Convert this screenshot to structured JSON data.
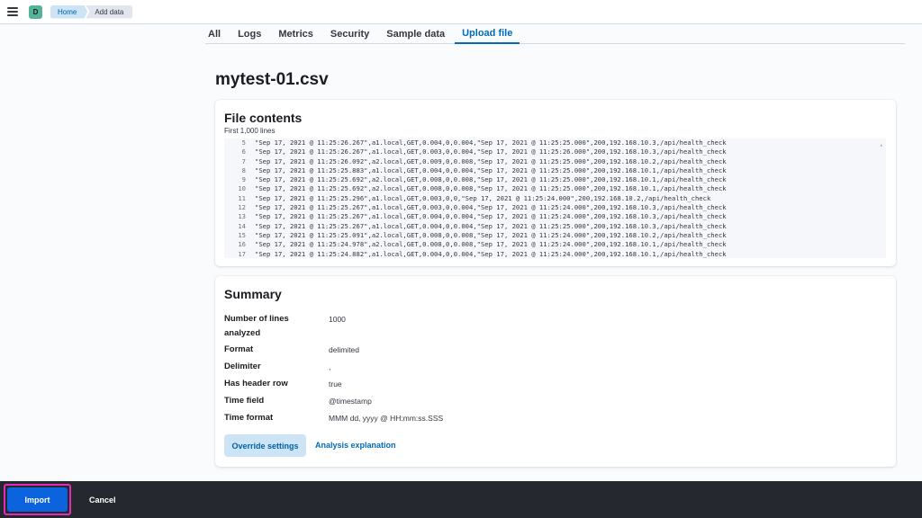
{
  "header": {
    "avatar_letter": "D",
    "breadcrumbs": [
      "Home",
      "Add data"
    ]
  },
  "tabs": [
    "All",
    "Logs",
    "Metrics",
    "Security",
    "Sample data",
    "Upload file"
  ],
  "active_tab": "Upload file",
  "file_name": "mytest-01.csv",
  "file_contents": {
    "title": "File contents",
    "subtitle": "First 1,000 lines",
    "lines": [
      {
        "n": "5",
        "text": "\"Sep 17, 2021 @ 11:25:26.267\",a1.local,GET,0.004,0,0.004,\"Sep 17, 2021 @ 11:25:25.000\",200,192.168.10.3,/api/health_check"
      },
      {
        "n": "6",
        "text": "\"Sep 17, 2021 @ 11:25:26.267\",a1.local,GET,0.003,0,0.004,\"Sep 17, 2021 @ 11:25:26.000\",200,192.168.10.3,/api/health_check"
      },
      {
        "n": "7",
        "text": "\"Sep 17, 2021 @ 11:25:26.092\",a2.local,GET,0.009,0,0.008,\"Sep 17, 2021 @ 11:25:25.000\",200,192.168.10.2,/api/health_check"
      },
      {
        "n": "8",
        "text": "\"Sep 17, 2021 @ 11:25:25.883\",a1.local,GET,0.004,0,0.004,\"Sep 17, 2021 @ 11:25:25.000\",200,192.168.10.1,/api/health_check"
      },
      {
        "n": "9",
        "text": "\"Sep 17, 2021 @ 11:25:25.692\",a2.local,GET,0.008,0,0.008,\"Sep 17, 2021 @ 11:25:25.000\",200,192.168.10.1,/api/health_check"
      },
      {
        "n": "10",
        "text": "\"Sep 17, 2021 @ 11:25:25.692\",a2.local,GET,0.008,0,0.008,\"Sep 17, 2021 @ 11:25:25.000\",200,192.168.10.1,/api/health_check"
      },
      {
        "n": "11",
        "text": "\"Sep 17, 2021 @ 11:25:25.296\",a1.local,GET,0.003,0,0,\"Sep 17, 2021 @ 11:25:24.000\",200,192.168.10.2,/api/health_check"
      },
      {
        "n": "12",
        "text": "\"Sep 17, 2021 @ 11:25:25.267\",a1.local,GET,0.003,0,0.004,\"Sep 17, 2021 @ 11:25:24.000\",200,192.168.10.3,/api/health_check"
      },
      {
        "n": "13",
        "text": "\"Sep 17, 2021 @ 11:25:25.267\",a1.local,GET,0.004,0,0.004,\"Sep 17, 2021 @ 11:25:24.000\",200,192.168.10.3,/api/health_check"
      },
      {
        "n": "14",
        "text": "\"Sep 17, 2021 @ 11:25:25.267\",a1.local,GET,0.004,0,0.004,\"Sep 17, 2021 @ 11:25:25.000\",200,192.168.10.3,/api/health_check"
      },
      {
        "n": "15",
        "text": "\"Sep 17, 2021 @ 11:25:25.091\",a2.local,GET,0.008,0,0.008,\"Sep 17, 2021 @ 11:25:24.000\",200,192.168.10.2,/api/health_check"
      },
      {
        "n": "16",
        "text": "\"Sep 17, 2021 @ 11:25:24.978\",a2.local,GET,0.008,0,0.008,\"Sep 17, 2021 @ 11:25:24.000\",200,192.168.10.1,/api/health_check"
      },
      {
        "n": "17",
        "text": "\"Sep 17, 2021 @ 11:25:24.882\",a1.local,GET,0.004,0,0.004,\"Sep 17, 2021 @ 11:25:24.000\",200,192.168.10.1,/api/health_check"
      }
    ]
  },
  "summary": {
    "title": "Summary",
    "rows": [
      {
        "label": "Number of lines",
        "label2": "analyzed",
        "value": "1000"
      },
      {
        "label": "Format",
        "value": "delimited"
      },
      {
        "label": "Delimiter",
        "value": ","
      },
      {
        "label": "Has header row",
        "value": "true"
      },
      {
        "label": "Time field",
        "value": "@timestamp"
      },
      {
        "label": "Time format",
        "value": "MMM dd, yyyy @ HH:mm:ss.SSS"
      }
    ],
    "override_label": "Override settings",
    "analysis_label": "Analysis explanation"
  },
  "footer": {
    "import_label": "Import",
    "cancel_label": "Cancel"
  },
  "colors": {
    "accent": "#006bb8",
    "import_button": "#0b64dd",
    "highlight_border": "#e22bb7",
    "footer_bg": "#25282f"
  }
}
